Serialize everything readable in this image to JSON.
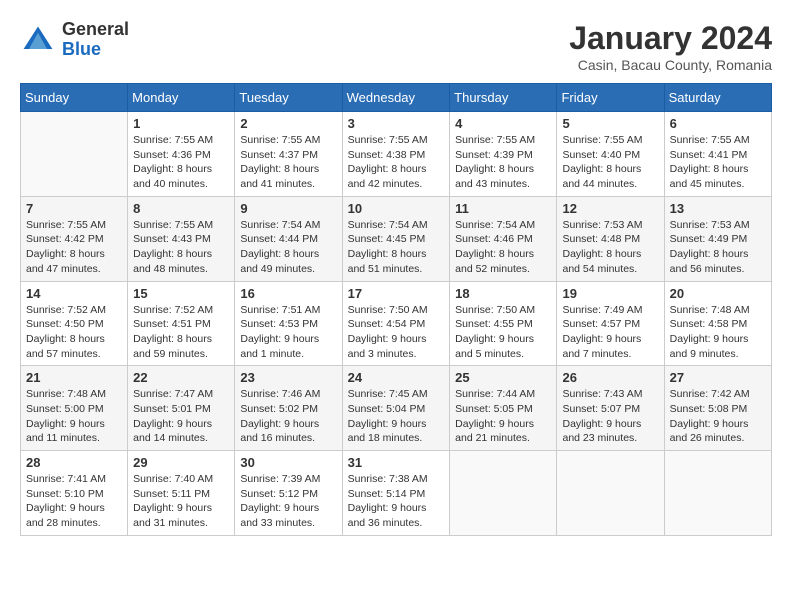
{
  "header": {
    "logo_general": "General",
    "logo_blue": "Blue",
    "title": "January 2024",
    "location": "Casin, Bacau County, Romania"
  },
  "calendar": {
    "days_of_week": [
      "Sunday",
      "Monday",
      "Tuesday",
      "Wednesday",
      "Thursday",
      "Friday",
      "Saturday"
    ],
    "weeks": [
      [
        {
          "day": "",
          "sunrise": "",
          "sunset": "",
          "daylight": ""
        },
        {
          "day": "1",
          "sunrise": "Sunrise: 7:55 AM",
          "sunset": "Sunset: 4:36 PM",
          "daylight": "Daylight: 8 hours and 40 minutes."
        },
        {
          "day": "2",
          "sunrise": "Sunrise: 7:55 AM",
          "sunset": "Sunset: 4:37 PM",
          "daylight": "Daylight: 8 hours and 41 minutes."
        },
        {
          "day": "3",
          "sunrise": "Sunrise: 7:55 AM",
          "sunset": "Sunset: 4:38 PM",
          "daylight": "Daylight: 8 hours and 42 minutes."
        },
        {
          "day": "4",
          "sunrise": "Sunrise: 7:55 AM",
          "sunset": "Sunset: 4:39 PM",
          "daylight": "Daylight: 8 hours and 43 minutes."
        },
        {
          "day": "5",
          "sunrise": "Sunrise: 7:55 AM",
          "sunset": "Sunset: 4:40 PM",
          "daylight": "Daylight: 8 hours and 44 minutes."
        },
        {
          "day": "6",
          "sunrise": "Sunrise: 7:55 AM",
          "sunset": "Sunset: 4:41 PM",
          "daylight": "Daylight: 8 hours and 45 minutes."
        }
      ],
      [
        {
          "day": "7",
          "sunrise": "Sunrise: 7:55 AM",
          "sunset": "Sunset: 4:42 PM",
          "daylight": "Daylight: 8 hours and 47 minutes."
        },
        {
          "day": "8",
          "sunrise": "Sunrise: 7:55 AM",
          "sunset": "Sunset: 4:43 PM",
          "daylight": "Daylight: 8 hours and 48 minutes."
        },
        {
          "day": "9",
          "sunrise": "Sunrise: 7:54 AM",
          "sunset": "Sunset: 4:44 PM",
          "daylight": "Daylight: 8 hours and 49 minutes."
        },
        {
          "day": "10",
          "sunrise": "Sunrise: 7:54 AM",
          "sunset": "Sunset: 4:45 PM",
          "daylight": "Daylight: 8 hours and 51 minutes."
        },
        {
          "day": "11",
          "sunrise": "Sunrise: 7:54 AM",
          "sunset": "Sunset: 4:46 PM",
          "daylight": "Daylight: 8 hours and 52 minutes."
        },
        {
          "day": "12",
          "sunrise": "Sunrise: 7:53 AM",
          "sunset": "Sunset: 4:48 PM",
          "daylight": "Daylight: 8 hours and 54 minutes."
        },
        {
          "day": "13",
          "sunrise": "Sunrise: 7:53 AM",
          "sunset": "Sunset: 4:49 PM",
          "daylight": "Daylight: 8 hours and 56 minutes."
        }
      ],
      [
        {
          "day": "14",
          "sunrise": "Sunrise: 7:52 AM",
          "sunset": "Sunset: 4:50 PM",
          "daylight": "Daylight: 8 hours and 57 minutes."
        },
        {
          "day": "15",
          "sunrise": "Sunrise: 7:52 AM",
          "sunset": "Sunset: 4:51 PM",
          "daylight": "Daylight: 8 hours and 59 minutes."
        },
        {
          "day": "16",
          "sunrise": "Sunrise: 7:51 AM",
          "sunset": "Sunset: 4:53 PM",
          "daylight": "Daylight: 9 hours and 1 minute."
        },
        {
          "day": "17",
          "sunrise": "Sunrise: 7:50 AM",
          "sunset": "Sunset: 4:54 PM",
          "daylight": "Daylight: 9 hours and 3 minutes."
        },
        {
          "day": "18",
          "sunrise": "Sunrise: 7:50 AM",
          "sunset": "Sunset: 4:55 PM",
          "daylight": "Daylight: 9 hours and 5 minutes."
        },
        {
          "day": "19",
          "sunrise": "Sunrise: 7:49 AM",
          "sunset": "Sunset: 4:57 PM",
          "daylight": "Daylight: 9 hours and 7 minutes."
        },
        {
          "day": "20",
          "sunrise": "Sunrise: 7:48 AM",
          "sunset": "Sunset: 4:58 PM",
          "daylight": "Daylight: 9 hours and 9 minutes."
        }
      ],
      [
        {
          "day": "21",
          "sunrise": "Sunrise: 7:48 AM",
          "sunset": "Sunset: 5:00 PM",
          "daylight": "Daylight: 9 hours and 11 minutes."
        },
        {
          "day": "22",
          "sunrise": "Sunrise: 7:47 AM",
          "sunset": "Sunset: 5:01 PM",
          "daylight": "Daylight: 9 hours and 14 minutes."
        },
        {
          "day": "23",
          "sunrise": "Sunrise: 7:46 AM",
          "sunset": "Sunset: 5:02 PM",
          "daylight": "Daylight: 9 hours and 16 minutes."
        },
        {
          "day": "24",
          "sunrise": "Sunrise: 7:45 AM",
          "sunset": "Sunset: 5:04 PM",
          "daylight": "Daylight: 9 hours and 18 minutes."
        },
        {
          "day": "25",
          "sunrise": "Sunrise: 7:44 AM",
          "sunset": "Sunset: 5:05 PM",
          "daylight": "Daylight: 9 hours and 21 minutes."
        },
        {
          "day": "26",
          "sunrise": "Sunrise: 7:43 AM",
          "sunset": "Sunset: 5:07 PM",
          "daylight": "Daylight: 9 hours and 23 minutes."
        },
        {
          "day": "27",
          "sunrise": "Sunrise: 7:42 AM",
          "sunset": "Sunset: 5:08 PM",
          "daylight": "Daylight: 9 hours and 26 minutes."
        }
      ],
      [
        {
          "day": "28",
          "sunrise": "Sunrise: 7:41 AM",
          "sunset": "Sunset: 5:10 PM",
          "daylight": "Daylight: 9 hours and 28 minutes."
        },
        {
          "day": "29",
          "sunrise": "Sunrise: 7:40 AM",
          "sunset": "Sunset: 5:11 PM",
          "daylight": "Daylight: 9 hours and 31 minutes."
        },
        {
          "day": "30",
          "sunrise": "Sunrise: 7:39 AM",
          "sunset": "Sunset: 5:12 PM",
          "daylight": "Daylight: 9 hours and 33 minutes."
        },
        {
          "day": "31",
          "sunrise": "Sunrise: 7:38 AM",
          "sunset": "Sunset: 5:14 PM",
          "daylight": "Daylight: 9 hours and 36 minutes."
        },
        {
          "day": "",
          "sunrise": "",
          "sunset": "",
          "daylight": ""
        },
        {
          "day": "",
          "sunrise": "",
          "sunset": "",
          "daylight": ""
        },
        {
          "day": "",
          "sunrise": "",
          "sunset": "",
          "daylight": ""
        }
      ]
    ]
  }
}
